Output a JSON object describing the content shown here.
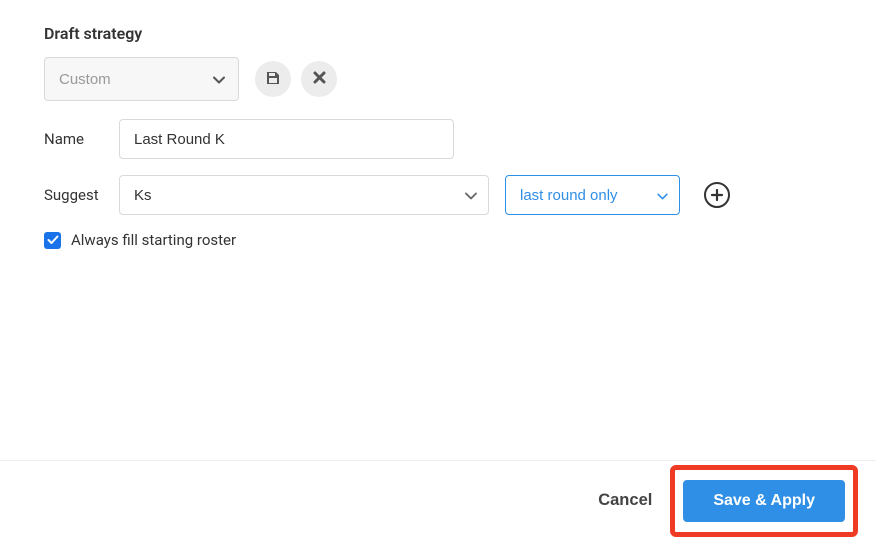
{
  "section_title": "Draft strategy",
  "strategy_select": {
    "value": "Custom"
  },
  "name_row": {
    "label": "Name",
    "value": "Last Round K"
  },
  "suggest_row": {
    "label": "Suggest",
    "position_value": "Ks",
    "round_value": "last round only"
  },
  "checkbox": {
    "label": "Always fill starting roster",
    "checked": true
  },
  "footer": {
    "cancel_label": "Cancel",
    "save_apply_label": "Save & Apply"
  }
}
